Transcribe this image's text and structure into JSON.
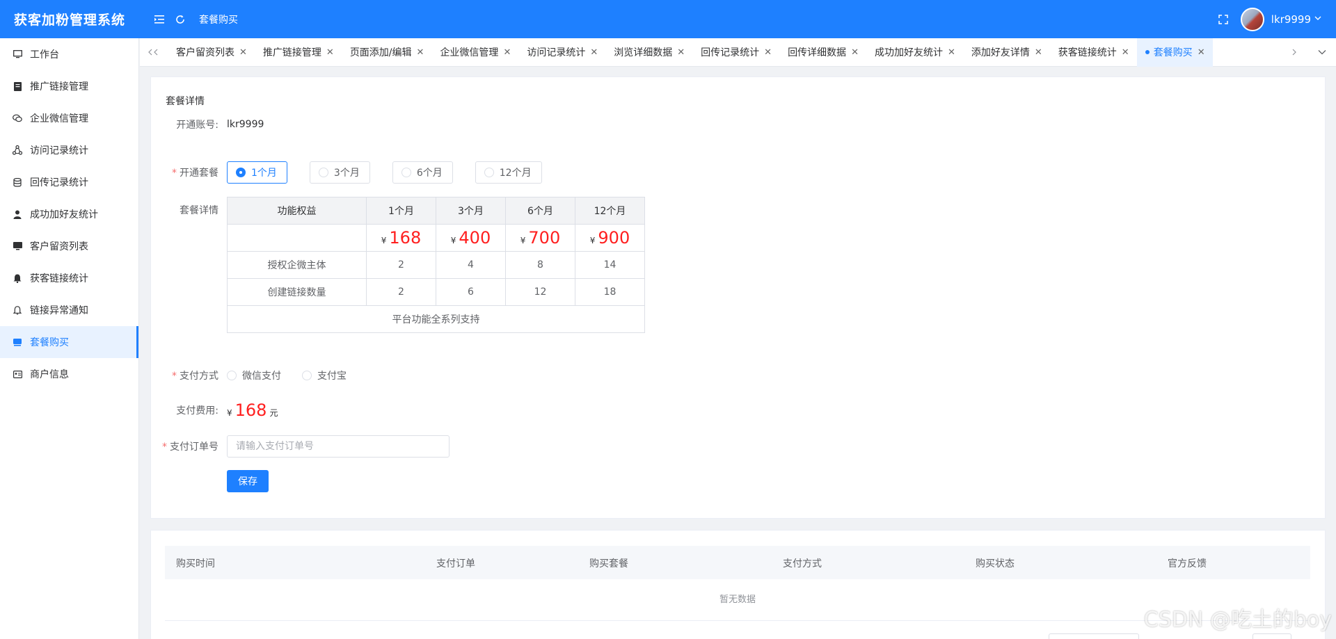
{
  "header": {
    "app_title": "获客加粉管理系统",
    "breadcrumb": "套餐购买",
    "username": "lkr9999",
    "menu_icon": "menu-fold-icon",
    "refresh_icon": "refresh-icon",
    "fullscreen_icon": "fullscreen-icon"
  },
  "sidebar": {
    "items": [
      {
        "label": "工作台",
        "icon": "monitor-icon"
      },
      {
        "label": "推广链接管理",
        "icon": "document-icon"
      },
      {
        "label": "企业微信管理",
        "icon": "chat-icon"
      },
      {
        "label": "访问记录统计",
        "icon": "share-icon"
      },
      {
        "label": "回传记录统计",
        "icon": "database-icon"
      },
      {
        "label": "成功加好友统计",
        "icon": "user-icon"
      },
      {
        "label": "客户留资列表",
        "icon": "screen-icon"
      },
      {
        "label": "获客链接统计",
        "icon": "bell-filled-icon"
      },
      {
        "label": "链接异常通知",
        "icon": "bell-icon"
      },
      {
        "label": "套餐购买",
        "icon": "box-icon"
      },
      {
        "label": "商户信息",
        "icon": "idcard-icon"
      }
    ]
  },
  "tabs": [
    {
      "label": "客户留资列表"
    },
    {
      "label": "推广链接管理"
    },
    {
      "label": "页面添加/编辑"
    },
    {
      "label": "企业微信管理"
    },
    {
      "label": "访问记录统计"
    },
    {
      "label": "浏览详细数据"
    },
    {
      "label": "回传记录统计"
    },
    {
      "label": "回传详细数据"
    },
    {
      "label": "成功加好友统计"
    },
    {
      "label": "添加好友详情"
    },
    {
      "label": "获客链接统计"
    },
    {
      "label": "套餐购买",
      "active": true
    }
  ],
  "form": {
    "section_title": "套餐详情",
    "account_label": "开通账号:",
    "account_value": "lkr9999",
    "plan_label": "开通套餐",
    "plan_options": [
      "1个月",
      "3个月",
      "6个月",
      "12个月"
    ],
    "plan_selected": "1个月",
    "detail_label": "套餐详情",
    "table": {
      "headers": [
        "功能权益",
        "1个月",
        "3个月",
        "6个月",
        "12个月"
      ],
      "currency": "¥",
      "prices": [
        "168",
        "400",
        "700",
        "900"
      ],
      "rows": [
        {
          "name": "授权企微主体",
          "values": [
            "2",
            "4",
            "8",
            "14"
          ]
        },
        {
          "name": "创建链接数量",
          "values": [
            "2",
            "6",
            "12",
            "18"
          ]
        }
      ],
      "footer": "平台功能全系列支持"
    },
    "pay_method_label": "支付方式",
    "pay_methods": [
      "微信支付",
      "支付宝"
    ],
    "fee_label": "支付费用:",
    "fee_currency": "¥",
    "fee_value": "168",
    "fee_unit": "元",
    "order_label": "支付订单号",
    "order_placeholder": "请输入支付订单号",
    "order_value": "",
    "save_label": "保存"
  },
  "history": {
    "columns": [
      "购买时间",
      "支付订单",
      "购买套餐",
      "支付方式",
      "购买状态",
      "官方反馈"
    ],
    "empty_text": "暂无数据"
  },
  "watermark": "CSDN @吃土的boy",
  "colors": {
    "primary": "#1e80ff",
    "price": "#ff1f1f",
    "required": "#f56c6c"
  }
}
